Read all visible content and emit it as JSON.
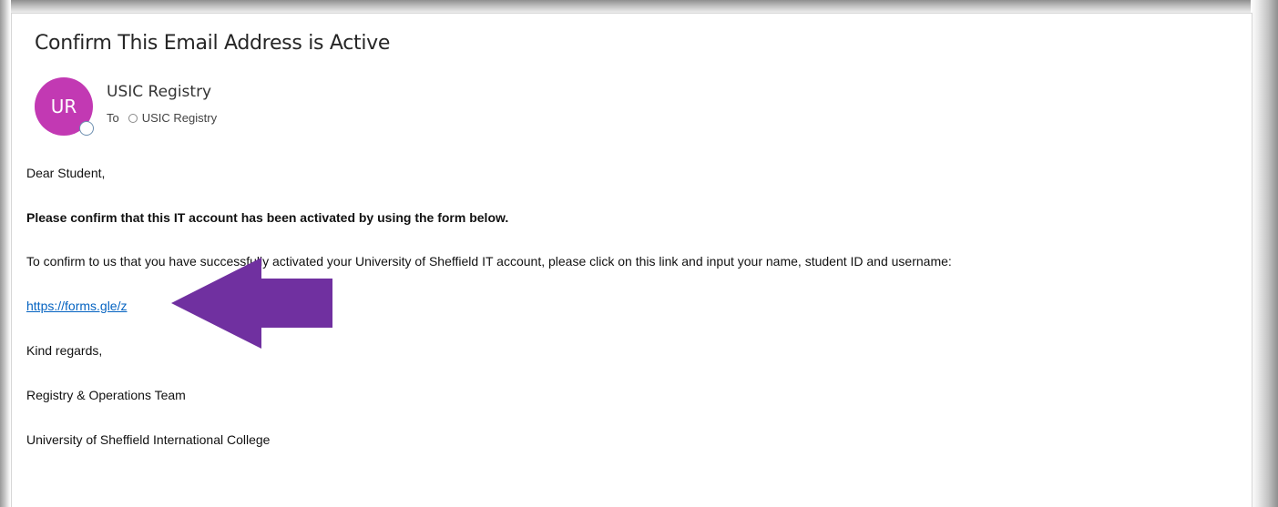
{
  "email": {
    "subject": "Confirm This Email Address is Active",
    "avatar_initials": "UR",
    "sender_name": "USIC Registry",
    "to_label": "To",
    "recipient": "USIC Registry",
    "greeting": "Dear Student,",
    "bold_line": "Please confirm that this IT account has been activated by using the form below.",
    "instruction": "To confirm to us that you have successfully activated your University of Sheffield IT account, please click on this link and input your name, student ID and username:",
    "link_text": "https://forms.gle/z",
    "closing": "Kind regards,",
    "team": "Registry & Operations Team",
    "organization": "University of Sheffield International College"
  },
  "colors": {
    "avatar": "#c239b3",
    "link": "#0563c1",
    "arrow": "#7030a0"
  },
  "icons": {
    "arrow": "left-pointing-arrow",
    "presence": "presence-status-icon"
  }
}
